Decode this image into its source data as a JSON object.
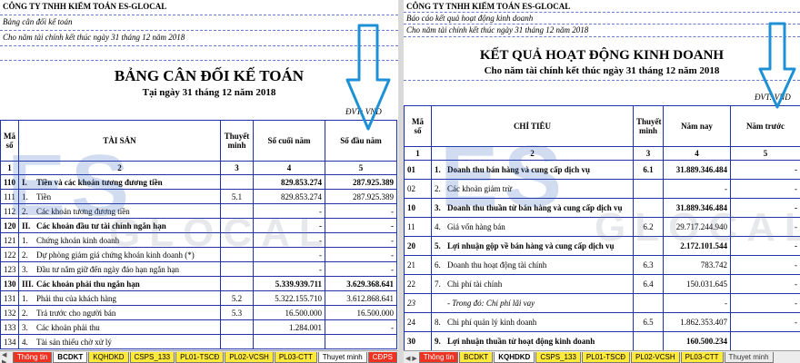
{
  "left": {
    "company": "CÔNG TY TNHH KIỂM TOÁN ES-GLOCAL",
    "report_line": "Bảng cân đối kế toán",
    "period_line": "Cho năm tài chính kết thúc ngày 31 tháng 12 năm 2018",
    "title": "BẢNG CÂN ĐỐI KẾ TOÁN",
    "subtitle": "Tại ngày 31 tháng 12 năm 2018",
    "unit": "ĐVT: VND",
    "headers": [
      "Mã số",
      "TÀI SẢN",
      "Thuyết minh",
      "Số cuối năm",
      "Số đầu năm"
    ],
    "col_numbers": [
      "1",
      "2",
      "3",
      "4",
      "5"
    ],
    "rows": [
      {
        "code": "110",
        "num": "I.",
        "label": "Tiền và các khoản tương đương tiền",
        "note": "",
        "end": "829.853.274",
        "begin": "287.925.389",
        "bold": true
      },
      {
        "code": "111",
        "num": "1.",
        "label": "Tiền",
        "note": "5.1",
        "end": "829.853.274",
        "begin": "287.925.389",
        "bold": false
      },
      {
        "code": "112",
        "num": "2.",
        "label": "Các khoản tương đương tiền",
        "note": "",
        "end": "-",
        "begin": "-",
        "bold": false
      },
      {
        "code": "120",
        "num": "II.",
        "label": "Các khoản đầu tư tài chính ngắn hạn",
        "note": "",
        "end": "-",
        "begin": "-",
        "bold": true
      },
      {
        "code": "121",
        "num": "1.",
        "label": "Chứng khoán kinh doanh",
        "note": "",
        "end": "-",
        "begin": "-",
        "bold": false
      },
      {
        "code": "122",
        "num": "2.",
        "label": "Dự phòng giảm giá chứng khoán kinh doanh (*)",
        "note": "",
        "end": "-",
        "begin": "-",
        "bold": false
      },
      {
        "code": "123",
        "num": "3.",
        "label": "Đầu tư nắm giữ đến ngày đáo hạn ngắn hạn",
        "note": "",
        "end": "-",
        "begin": "-",
        "bold": false
      },
      {
        "code": "130",
        "num": "III.",
        "label": "Các khoản phải thu ngắn hạn",
        "note": "",
        "end": "5.339.939.711",
        "begin": "3.629.368.641",
        "bold": true
      },
      {
        "code": "131",
        "num": "1.",
        "label": "Phải thu của khách hàng",
        "note": "5.2",
        "end": "5.322.155.710",
        "begin": "3.612.868.641",
        "bold": false
      },
      {
        "code": "132",
        "num": "2.",
        "label": "Trả trước cho người bán",
        "note": "5.3",
        "end": "16.500.000",
        "begin": "16.500.000",
        "bold": false
      },
      {
        "code": "133",
        "num": "3.",
        "label": "Các khoản phải thu",
        "note": "",
        "end": "1.284.001",
        "begin": "-",
        "bold": false
      },
      {
        "code": "134",
        "num": "4.",
        "label": "Tài sản thiếu chờ xử lý",
        "note": "",
        "end": "",
        "begin": "",
        "bold": false
      }
    ],
    "tabs": [
      {
        "label": "Thông tin",
        "style": "red"
      },
      {
        "label": "BCDKT",
        "style": "active"
      },
      {
        "label": "KQHDKD",
        "style": "yellow"
      },
      {
        "label": "CSPS_133",
        "style": "yellow"
      },
      {
        "label": "PL01-TSCĐ",
        "style": "yellow"
      },
      {
        "label": "PL02-VCSH",
        "style": "yellow"
      },
      {
        "label": "PL03-CTT",
        "style": "yellow"
      },
      {
        "label": "Thuyet minh",
        "style": "white"
      },
      {
        "label": "CĐPS",
        "style": "red"
      }
    ]
  },
  "right": {
    "company": "CÔNG TY TNHH KIỂM TOÁN ES-GLOCAL",
    "report_line": "Báo cáo kết quả hoạt động kinh doanh",
    "period_line": "Cho năm tài chính kết thúc ngày 31 tháng 12 năm 2018",
    "title": "KẾT QUẢ HOẠT ĐỘNG KINH DOANH",
    "subtitle": "Cho năm tài chính kết thúc ngày 31 tháng 12 năm 2018",
    "unit": "ĐVT: VND",
    "headers": [
      "Mã số",
      "CHỈ TIÊU",
      "Thuyết minh",
      "Năm nay",
      "Năm trước"
    ],
    "col_numbers": [
      "1",
      "2",
      "3",
      "4",
      "5"
    ],
    "rows": [
      {
        "code": "01",
        "num": "1.",
        "label": "Doanh thu bán hàng và cung cấp dịch vụ",
        "note": "6.1",
        "cur": "31.889.346.484",
        "prev": "-",
        "bold": true,
        "italic": false
      },
      {
        "code": "02",
        "num": "2.",
        "label": "Các khoản giảm trừ",
        "note": "",
        "cur": "-",
        "prev": "-",
        "bold": false,
        "italic": false
      },
      {
        "code": "10",
        "num": "3.",
        "label": "Doanh thu thuần từ bán hàng và cung cấp dịch vụ",
        "note": "",
        "cur": "31.889.346.484",
        "prev": "-",
        "bold": true,
        "italic": false
      },
      {
        "code": "11",
        "num": "4.",
        "label": "Giá vốn hàng bán",
        "note": "6.2",
        "cur": "29.717.244.940",
        "prev": "-",
        "bold": false,
        "italic": false
      },
      {
        "code": "20",
        "num": "5.",
        "label": "Lợi nhuận gộp về bán hàng và cung cấp dịch vụ",
        "note": "",
        "cur": "2.172.101.544",
        "prev": "-",
        "bold": true,
        "italic": false
      },
      {
        "code": "21",
        "num": "6.",
        "label": "Doanh thu hoạt động tài chính",
        "note": "6.3",
        "cur": "783.742",
        "prev": "-",
        "bold": false,
        "italic": false
      },
      {
        "code": "22",
        "num": "7.",
        "label": "Chi phí tài chính",
        "note": "6.4",
        "cur": "150.031.645",
        "prev": "-",
        "bold": false,
        "italic": false
      },
      {
        "code": "23",
        "num": "",
        "label": "- Trong đó: Chi phí lãi vay",
        "note": "",
        "cur": "-",
        "prev": "-",
        "bold": false,
        "italic": true
      },
      {
        "code": "24",
        "num": "8.",
        "label": "Chi phí quản lý kinh doanh",
        "note": "6.5",
        "cur": "1.862.353.407",
        "prev": "-",
        "bold": false,
        "italic": false
      },
      {
        "code": "30",
        "num": "9.",
        "label": "Lợi nhuận thuần từ hoạt động kinh doanh",
        "note": "",
        "cur": "160.500.234",
        "prev": "",
        "bold": true,
        "italic": false
      }
    ],
    "tabs": [
      {
        "label": "Thông tin",
        "style": "red"
      },
      {
        "label": "BCDKT",
        "style": "yellow"
      },
      {
        "label": "KQHDKD",
        "style": "active"
      },
      {
        "label": "CSPS_133",
        "style": "yellow"
      },
      {
        "label": "PL01-TSCĐ",
        "style": "yellow"
      },
      {
        "label": "PL02-VCSH",
        "style": "yellow"
      },
      {
        "label": "PL03-CTT",
        "style": "yellow"
      },
      {
        "label": "Thuyet minh",
        "style": "gray"
      }
    ]
  },
  "watermark": {
    "top": "ES",
    "bottom": "GLOCAL"
  },
  "colors": {
    "grid": "#2233aa",
    "arrow": "#1e90d6",
    "watermark": "#2d5fb9",
    "tab_red": "#ee3322",
    "tab_yellow": "#ffe93a"
  },
  "icons": {
    "arrow": "arrow-down-icon"
  }
}
